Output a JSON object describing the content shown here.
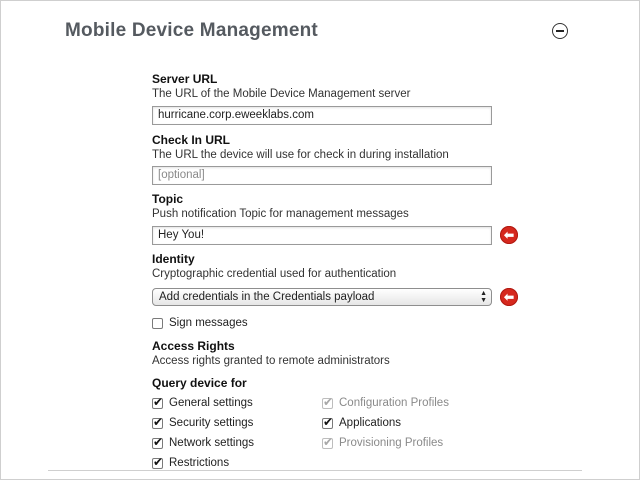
{
  "section": {
    "title": "Mobile Device Management"
  },
  "server_url": {
    "label": "Server URL",
    "description": "The URL of the Mobile Device Management server",
    "value": "hurricane.corp.eweeklabs.com"
  },
  "check_in_url": {
    "label": "Check In URL",
    "description": "The URL the device will use for check in during installation",
    "placeholder": "[optional]"
  },
  "topic": {
    "label": "Topic",
    "description": "Push notification Topic for management messages",
    "value": "Hey You!"
  },
  "identity": {
    "label": "Identity",
    "description": "Cryptographic credential used for authentication",
    "selected": "Add credentials in the Credentials payload"
  },
  "sign_messages": {
    "label": "Sign messages",
    "checked": false
  },
  "access_rights": {
    "label": "Access Rights",
    "description": "Access rights granted to remote administrators"
  },
  "query": {
    "label": "Query device for",
    "items": [
      {
        "label": "General settings",
        "checked": true,
        "enabled": true
      },
      {
        "label": "Security settings",
        "checked": true,
        "enabled": true
      },
      {
        "label": "Network settings",
        "checked": true,
        "enabled": true
      },
      {
        "label": "Restrictions",
        "checked": true,
        "enabled": true
      },
      {
        "label": "Configuration Profiles",
        "checked": true,
        "enabled": false
      },
      {
        "label": "Applications",
        "checked": true,
        "enabled": true
      },
      {
        "label": "Provisioning Profiles",
        "checked": true,
        "enabled": false
      }
    ]
  },
  "colors": {
    "warning": "#d6281e",
    "title": "#555a60"
  }
}
